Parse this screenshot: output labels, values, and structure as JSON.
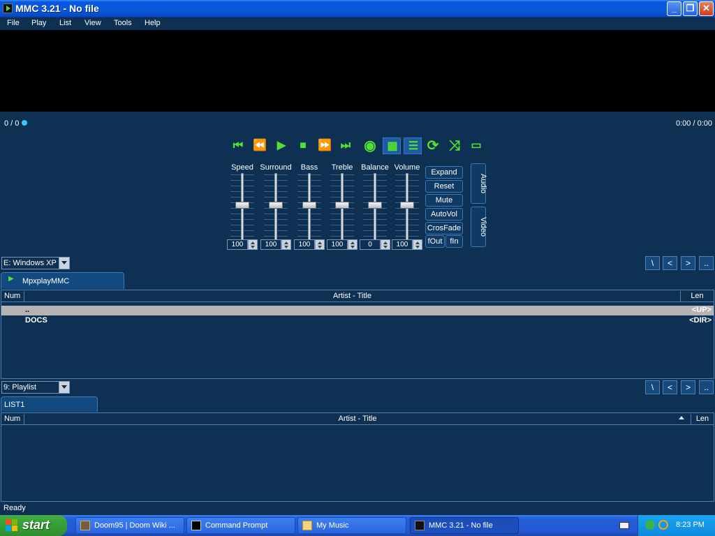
{
  "window": {
    "title": "MMC 3.21 - No file",
    "minimize": "_",
    "maximize": "❐",
    "close": "✕"
  },
  "menu": [
    "File",
    "Play",
    "List",
    "View",
    "Tools",
    "Help"
  ],
  "seek": {
    "position_left": "0 / 0",
    "time": "0:00 / 0:00"
  },
  "transport": [
    {
      "name": "prev-track",
      "glyph": "⏮"
    },
    {
      "name": "rewind",
      "glyph": "⏪"
    },
    {
      "name": "play",
      "glyph": "▶"
    },
    {
      "name": "stop",
      "glyph": "■"
    },
    {
      "name": "fast-forward",
      "glyph": "⏩"
    },
    {
      "name": "next-track",
      "glyph": "⏭"
    },
    {
      "name": "disc",
      "glyph": "◉"
    },
    {
      "name": "equalizer",
      "glyph": "▦"
    },
    {
      "name": "playlist",
      "glyph": "☰"
    },
    {
      "name": "repeat",
      "glyph": "⟳"
    },
    {
      "name": "shuffle",
      "glyph": "⤨"
    },
    {
      "name": "display",
      "glyph": "▭"
    }
  ],
  "sliders": [
    {
      "label": "Speed",
      "value": "100"
    },
    {
      "label": "Surround",
      "value": "100"
    },
    {
      "label": "Bass",
      "value": "100"
    },
    {
      "label": "Treble",
      "value": "100"
    },
    {
      "label": "Balance",
      "value": "0"
    },
    {
      "label": "Volume",
      "value": "100"
    }
  ],
  "side_buttons": {
    "expand": "Expand",
    "reset": "Reset",
    "mute": "Mute",
    "autovol": "AutoVol",
    "crossfade": "CrosFade",
    "fout": "fOut",
    "fin": "fIn"
  },
  "side_tabs": {
    "audio": "Audio",
    "video": "Video"
  },
  "nav_buttons": [
    "\\",
    "<",
    ">",
    ".."
  ],
  "browser": {
    "drive": "E:  Windows XP",
    "tab": "MpxplayMMC",
    "columns": {
      "num": "Num",
      "title": "Artist - Title",
      "len": "Len"
    },
    "rows": [
      {
        "title": "..",
        "len": "<UP>"
      },
      {
        "title": "DOCS",
        "len": "<DIR>"
      }
    ]
  },
  "playlist": {
    "selector": "9:  Playlist",
    "tab": "LIST1",
    "columns": {
      "num": "Num",
      "title": "Artist - Title",
      "len": "Len"
    }
  },
  "status": "Ready",
  "taskbar": {
    "start": "start",
    "tasks": [
      {
        "label": "Doom95 | Doom Wiki ..."
      },
      {
        "label": "Command Prompt"
      },
      {
        "label": "My Music"
      },
      {
        "label": "MMC 3.21 - No file"
      }
    ],
    "clock": "8:23 PM"
  },
  "colors": {
    "panel": "#0e3153",
    "accent_green": "#53e034",
    "seek_dot": "#37c9ff",
    "title_blue": "#0a58dc",
    "start_green": "#37a33a"
  }
}
